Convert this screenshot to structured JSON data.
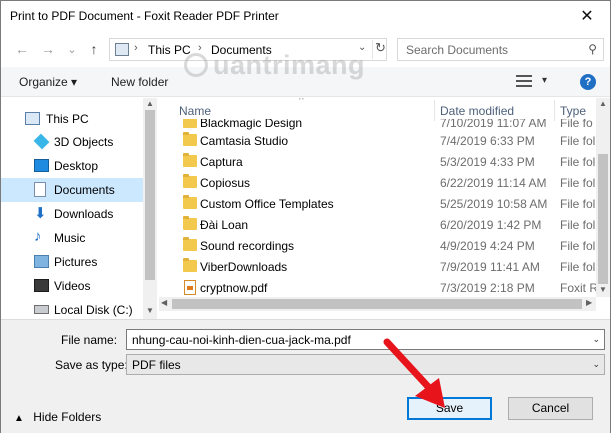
{
  "window": {
    "title": "Print to PDF Document - Foxit Reader PDF Printer",
    "close_glyph": "✕"
  },
  "nav": {
    "back_glyph": "←",
    "forward_glyph": "→",
    "recent_glyph": "⌄",
    "up_glyph": "↑",
    "breadcrumb": [
      "This PC",
      "Documents"
    ],
    "chevron": "›",
    "dropdown_glyph": "⌄",
    "refresh_glyph": "↻",
    "search_placeholder": "Search Documents",
    "search_glyph": "⚲"
  },
  "toolbar": {
    "organize_label": "Organize ▾",
    "new_folder_label": "New folder",
    "view_dd": "▾",
    "help_label": "?"
  },
  "sidebar": {
    "items": [
      {
        "label": "This PC",
        "icon": "pc-icon"
      },
      {
        "label": "3D Objects",
        "icon": "cube-icon"
      },
      {
        "label": "Desktop",
        "icon": "desktop-icon"
      },
      {
        "label": "Documents",
        "icon": "documents-icon",
        "selected": true
      },
      {
        "label": "Downloads",
        "icon": "download-icon"
      },
      {
        "label": "Music",
        "icon": "music-icon"
      },
      {
        "label": "Pictures",
        "icon": "pictures-icon"
      },
      {
        "label": "Videos",
        "icon": "videos-icon"
      },
      {
        "label": "Local Disk (C:)",
        "icon": "disk-icon"
      }
    ],
    "scroll_up": "▲",
    "scroll_down": "▼"
  },
  "files": {
    "columns": {
      "name": "Name",
      "date": "Date modified",
      "type": "Type",
      "sort_glyph": "^"
    },
    "partial_row": {
      "name": "Blackmagic Design",
      "date": "7/10/2019 11:07 AM",
      "type": "File fo"
    },
    "rows": [
      {
        "name": "Camtasia Studio",
        "date": "7/4/2019 6:33 PM",
        "type": "File fol",
        "kind": "folder"
      },
      {
        "name": "Captura",
        "date": "5/3/2019 4:33 PM",
        "type": "File fol",
        "kind": "folder"
      },
      {
        "name": "Copiosus",
        "date": "6/22/2019 11:14 AM",
        "type": "File fol",
        "kind": "folder"
      },
      {
        "name": "Custom Office Templates",
        "date": "5/25/2019 10:58 AM",
        "type": "File fol",
        "kind": "folder"
      },
      {
        "name": "Đài Loan",
        "date": "6/20/2019 1:42 PM",
        "type": "File fol",
        "kind": "folder"
      },
      {
        "name": "Sound recordings",
        "date": "4/9/2019 4:24 PM",
        "type": "File fol",
        "kind": "folder"
      },
      {
        "name": "ViberDownloads",
        "date": "7/9/2019 11:41 AM",
        "type": "File fol",
        "kind": "folder"
      },
      {
        "name": "cryptnow.pdf",
        "date": "7/3/2019 2:18 PM",
        "type": "Foxit R",
        "kind": "pdf"
      }
    ],
    "scroll_up": "▲",
    "scroll_down": "▼",
    "scroll_left": "◀",
    "scroll_right": "▶"
  },
  "form": {
    "file_name_label": "File name:",
    "file_name_value": "nhung-cau-noi-kinh-dien-cua-jack-ma.pdf",
    "save_type_label": "Save as type:",
    "save_type_value": "PDF files",
    "dropdown_glyph": "⌄"
  },
  "footer": {
    "hide_folders_label": "Hide Folders",
    "hide_glyph": "▲",
    "save_label": "Save",
    "cancel_label": "Cancel"
  },
  "watermark": {
    "text": "uantrimang"
  },
  "annotation": {
    "arrow_color": "#e8141c"
  }
}
